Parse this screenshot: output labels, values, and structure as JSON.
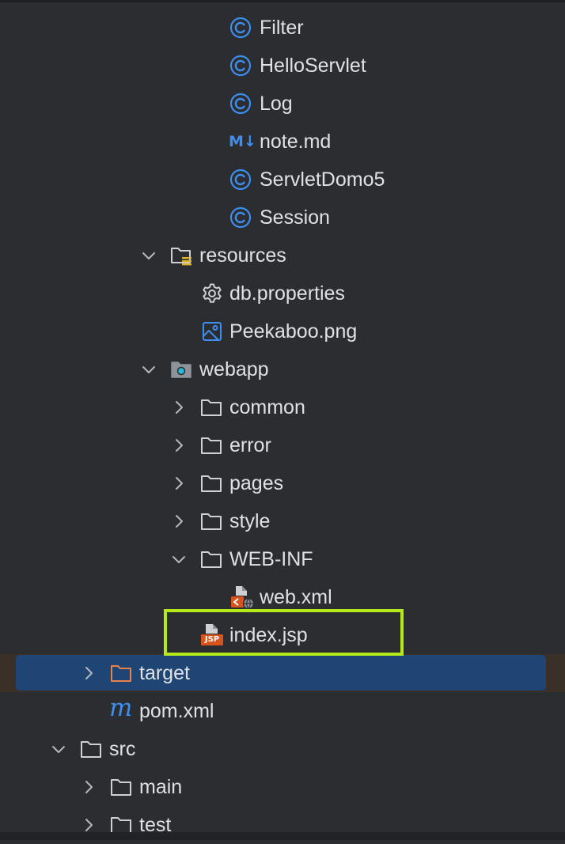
{
  "colors": {
    "background": "#2b2d30",
    "selection": "#1f4574",
    "highlight_border": "#b5ea1a",
    "class_icon": "#3d8eef",
    "jsp_icon": "#d9541c",
    "folder_stroke": "#ced0d6",
    "target_folder": "#e8824a"
  },
  "tree": {
    "items": [
      {
        "label": "Filter",
        "icon": "java-class-icon"
      },
      {
        "label": "HelloServlet",
        "icon": "java-class-icon"
      },
      {
        "label": "Log",
        "icon": "java-class-icon"
      },
      {
        "label": "note.md",
        "icon": "markdown-icon",
        "icon_text": "M↓"
      },
      {
        "label": "ServletDomo5",
        "icon": "java-class-icon"
      },
      {
        "label": "Session",
        "icon": "java-class-icon"
      },
      {
        "label": "resources",
        "icon": "resources-folder-icon",
        "expanded": true
      },
      {
        "label": "db.properties",
        "icon": "gear-icon"
      },
      {
        "label": "Peekaboo.png",
        "icon": "image-icon"
      },
      {
        "label": "webapp",
        "icon": "web-folder-icon",
        "expanded": true
      },
      {
        "label": "common",
        "icon": "folder-icon",
        "expanded": false
      },
      {
        "label": "error",
        "icon": "folder-icon",
        "expanded": false
      },
      {
        "label": "pages",
        "icon": "folder-icon",
        "expanded": false
      },
      {
        "label": "style",
        "icon": "folder-icon",
        "expanded": false
      },
      {
        "label": "WEB-INF",
        "icon": "folder-icon",
        "expanded": true
      },
      {
        "label": "web.xml",
        "icon": "xml-file-icon"
      },
      {
        "label": "index.jsp",
        "icon": "jsp-file-icon",
        "icon_text": "JSP"
      },
      {
        "label": "target",
        "icon": "excluded-folder-icon",
        "expanded": false,
        "selected": true
      },
      {
        "label": "pom.xml",
        "icon": "maven-icon",
        "icon_text": "m"
      },
      {
        "label": "src",
        "icon": "folder-icon",
        "expanded": true
      },
      {
        "label": "main",
        "icon": "folder-icon",
        "expanded": false
      },
      {
        "label": "test",
        "icon": "folder-icon",
        "expanded": false
      }
    ]
  }
}
